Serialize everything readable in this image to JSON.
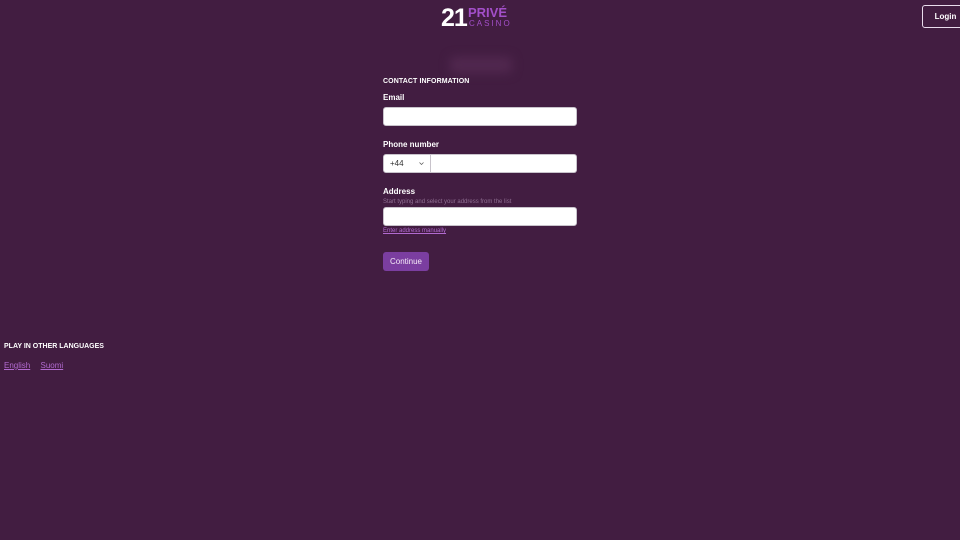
{
  "header": {
    "logo": {
      "number": "21",
      "word": "PRIVÉ",
      "sub": "CASINO",
      "accent_color": "#a34fc9"
    },
    "login_label": "Login"
  },
  "form": {
    "section_title": "CONTACT INFORMATION",
    "email": {
      "label": "Email",
      "value": "",
      "placeholder": ""
    },
    "phone": {
      "label": "Phone number",
      "country_code": "+44",
      "value": "",
      "placeholder": ""
    },
    "address": {
      "label": "Address",
      "hint": "Start typing and select your address from the list",
      "value": "",
      "placeholder": "",
      "manual_link": "Enter address manually"
    },
    "continue_label": "Continue"
  },
  "languages": {
    "title": "PLAY IN OTHER LANGUAGES",
    "items": [
      {
        "label": "English"
      },
      {
        "label": "Suomi"
      }
    ]
  },
  "colors": {
    "background": "#421d41",
    "button": "#7b3ea0",
    "link": "#b26ad0"
  }
}
